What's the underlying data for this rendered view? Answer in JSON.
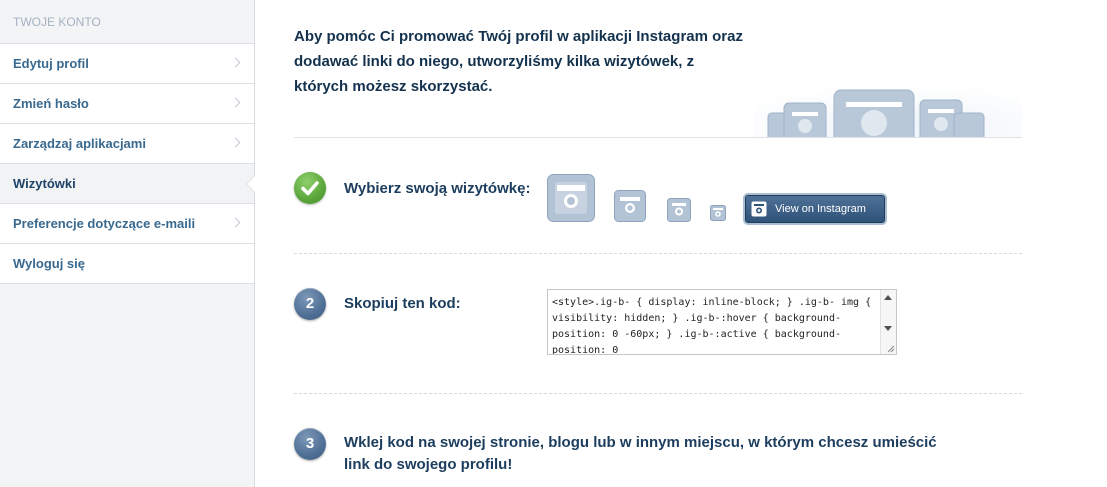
{
  "sidebar": {
    "heading": "TWOJE KONTO",
    "items": [
      {
        "label": "Edytuj profil",
        "active": false
      },
      {
        "label": "Zmień hasło",
        "active": false
      },
      {
        "label": "Zarządzaj aplikacjami",
        "active": false
      },
      {
        "label": "Wizytówki",
        "active": true
      },
      {
        "label": "Preferencje dotyczące e-maili",
        "active": false
      },
      {
        "label": "Wyloguj się",
        "active": false
      }
    ]
  },
  "main": {
    "intro": "Aby pomóc Ci promować Twój profil w aplikacji Instagram oraz dodawać linki do niego, utworzyliśmy kilka wizytówek, z których możesz skorzystać.",
    "steps": [
      {
        "number": "",
        "icon": "checkmark-icon",
        "label": "Wybierz swoją wizytówkę:"
      },
      {
        "number": "2",
        "label": "Skopiuj ten kod:"
      },
      {
        "number": "3",
        "label": "Wklej kod na swojej stronie, blogu lub w innym miejscu, w którym chcesz umieścić link do swojego profilu!"
      }
    ],
    "badges": {
      "button_label": "View on Instagram"
    },
    "code": "<style>.ig-b- { display: inline-block; } .ig-b- img { visibility: hidden; } .ig-b-:hover { background-position: 0 -60px; } .ig-b-:active { background-position: 0"
  },
  "colors": {
    "link": "#39698f",
    "heading": "#14324e",
    "step_blue": "#4f6f95",
    "step_green": "#5aa63a",
    "badge_fill": "#b3c3d6"
  }
}
